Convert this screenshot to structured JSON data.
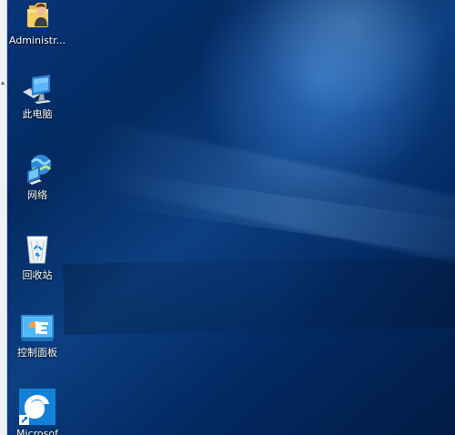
{
  "desktop": {
    "icons": [
      {
        "label": "Administr...",
        "icon": "user-folder-icon"
      },
      {
        "label": "此电脑",
        "icon": "computer-icon"
      },
      {
        "label": "网络",
        "icon": "network-icon"
      },
      {
        "label": "回收站",
        "icon": "recycle-bin-icon"
      },
      {
        "label": "控制面板",
        "icon": "control-panel-icon"
      },
      {
        "label": "Microsof",
        "icon": "edge-icon"
      }
    ]
  },
  "colors": {
    "wallpaper_dark": "#062a63",
    "wallpaper_light": "#57a2ff",
    "label_text": "#ffffff"
  }
}
